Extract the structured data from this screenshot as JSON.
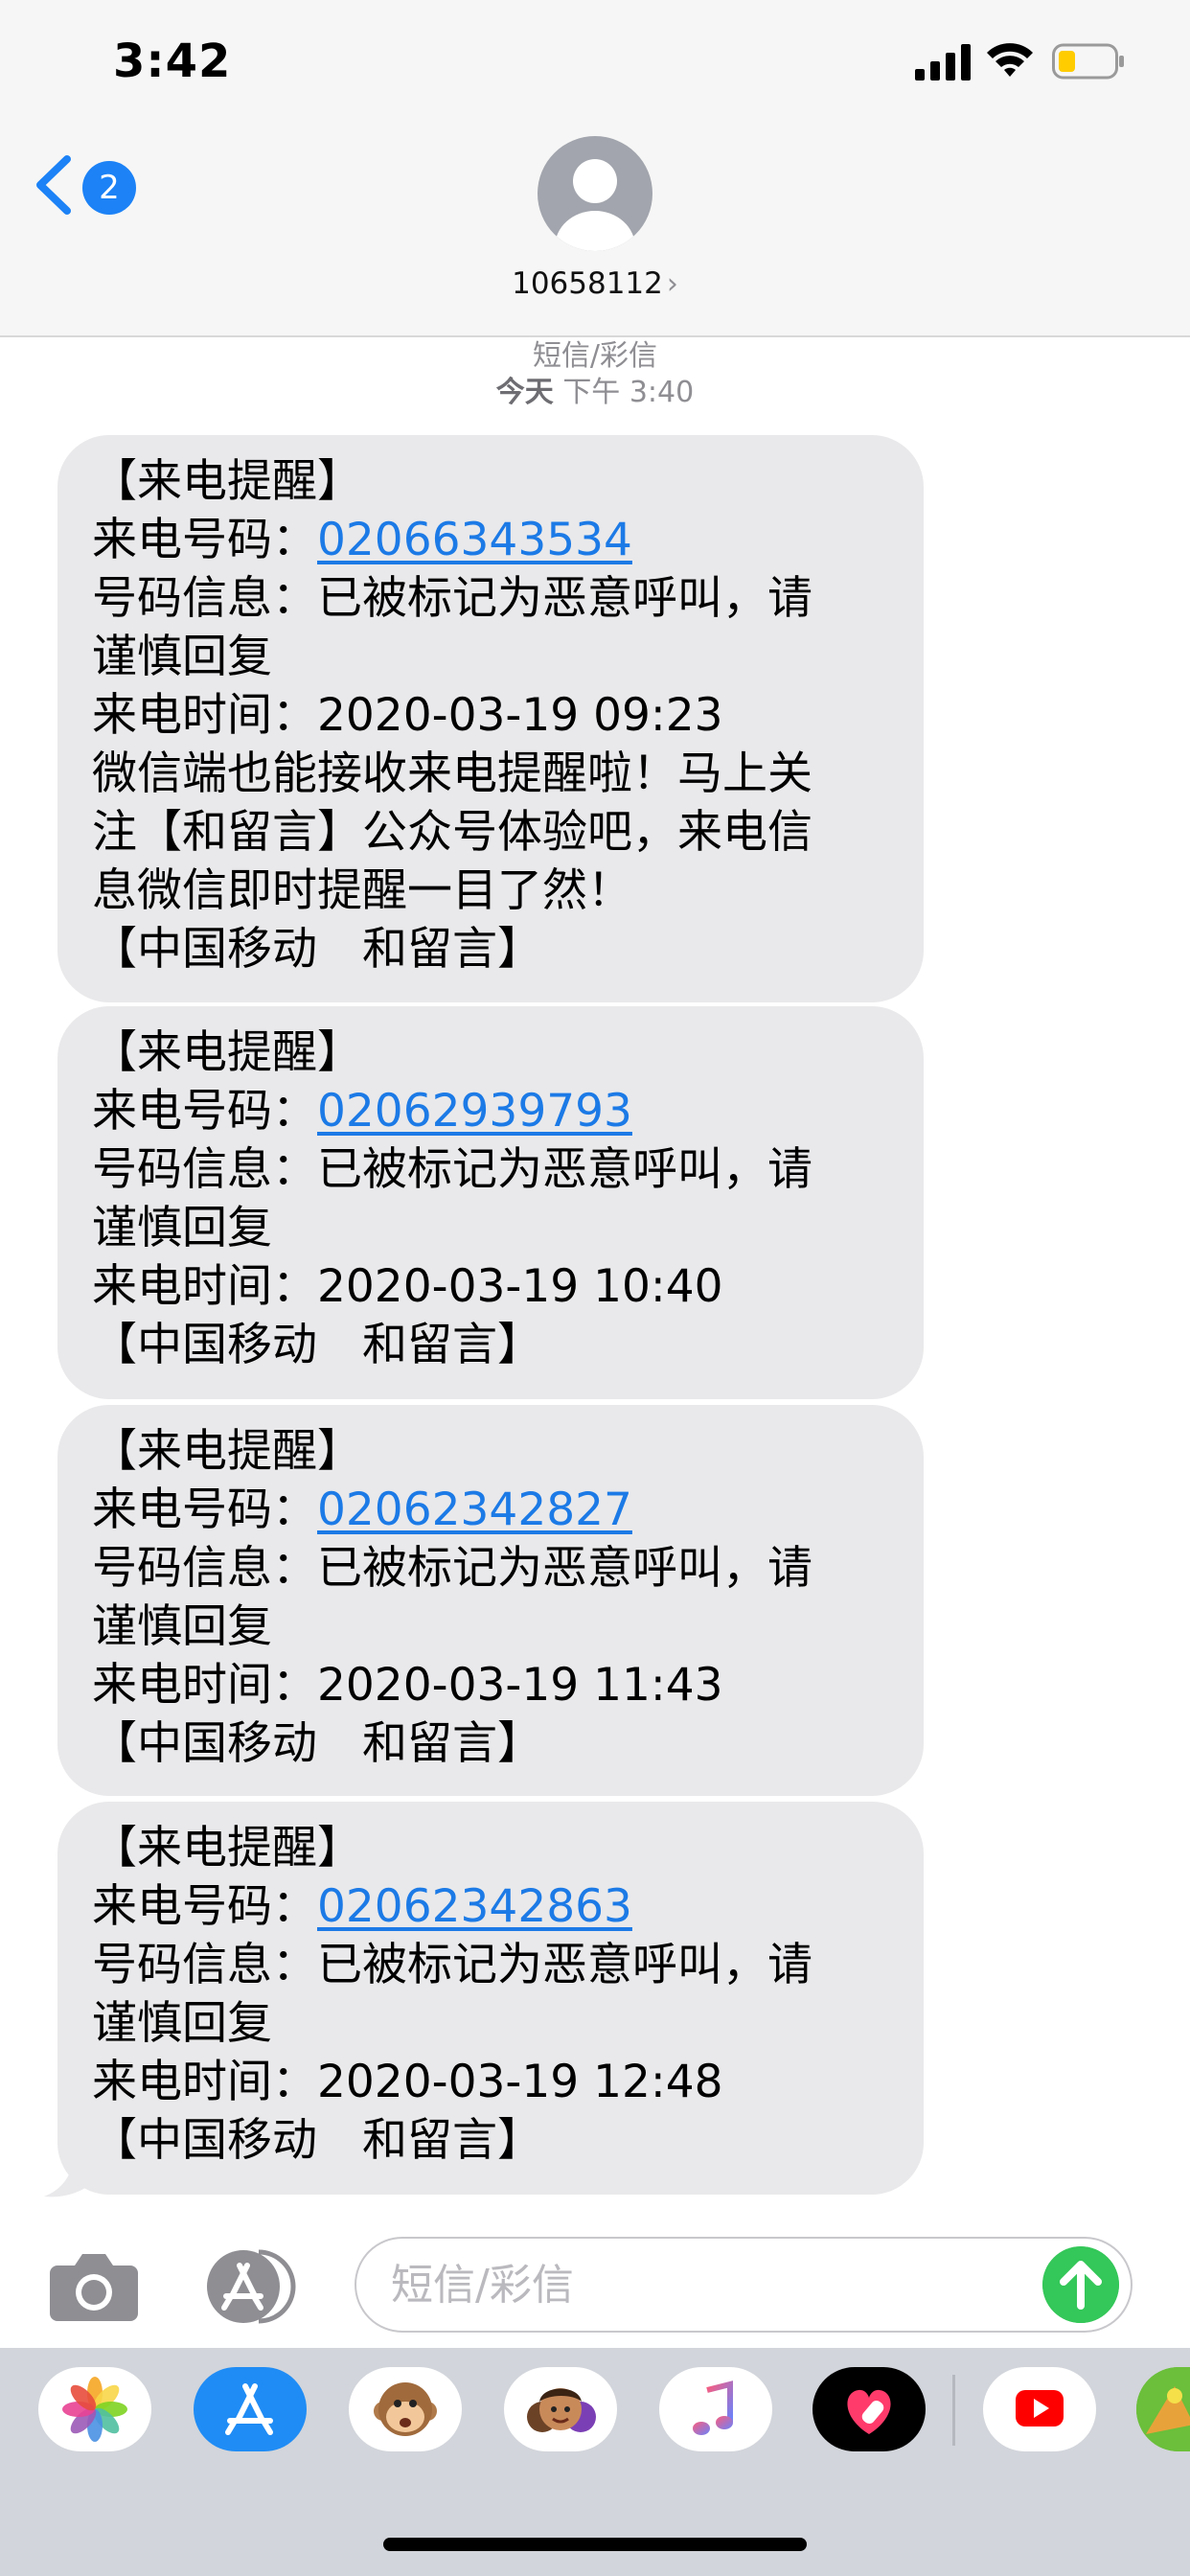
{
  "status_bar": {
    "time": "3:42"
  },
  "nav": {
    "back_badge": "2",
    "contact": "10658112",
    "chevron": "›"
  },
  "thread": {
    "label": "短信/彩信",
    "day": "今天",
    "time": "下午 3:40"
  },
  "messages": [
    {
      "title": "【来电提醒】",
      "number_label": "来电号码：",
      "number": "02066343534",
      "info_line1": "号码信息：已被标记为恶意呼叫，请",
      "info_line2": "谨慎回复",
      "time_label": "来电时间：",
      "time": "2020-03-19 09:23",
      "extra_line1": "微信端也能接收来电提醒啦！马上关",
      "extra_line2": "注【和留言】公众号体验吧，来电信",
      "extra_line3": "息微信即时提醒一目了然！",
      "signature": "【中国移动　和留言】"
    },
    {
      "title": "【来电提醒】",
      "number_label": "来电号码：",
      "number": "02062939793",
      "info_line1": "号码信息：已被标记为恶意呼叫，请",
      "info_line2": "谨慎回复",
      "time_label": "来电时间：",
      "time": "2020-03-19 10:40",
      "signature": "【中国移动　和留言】"
    },
    {
      "title": "【来电提醒】",
      "number_label": "来电号码：",
      "number": "02062342827",
      "info_line1": "号码信息：已被标记为恶意呼叫，请",
      "info_line2": "谨慎回复",
      "time_label": "来电时间：",
      "time": "2020-03-19 11:43",
      "signature": "【中国移动　和留言】"
    },
    {
      "title": "【来电提醒】",
      "number_label": "来电号码：",
      "number": "02062342863",
      "info_line1": "号码信息：已被标记为恶意呼叫，请",
      "info_line2": "谨慎回复",
      "time_label": "来电时间：",
      "time": "2020-03-19 12:48",
      "signature": "【中国移动　和留言】"
    }
  ],
  "composer": {
    "placeholder": "短信/彩信"
  },
  "app_drawer": {
    "apps": [
      "photos-icon",
      "app-store-icon",
      "memoji-monkey-icon",
      "memoji-people-icon",
      "music-icon",
      "digital-touch-icon",
      "youtube-icon",
      "game-icon"
    ]
  },
  "colors": {
    "link": "#1c7ae6",
    "bubble": "#e9e9eb",
    "badge": "#1c82f6",
    "send": "#34c759",
    "header_bg": "#f6f6f6",
    "drawer_bg": "#d2d5db",
    "battery": "#ffcc00"
  }
}
